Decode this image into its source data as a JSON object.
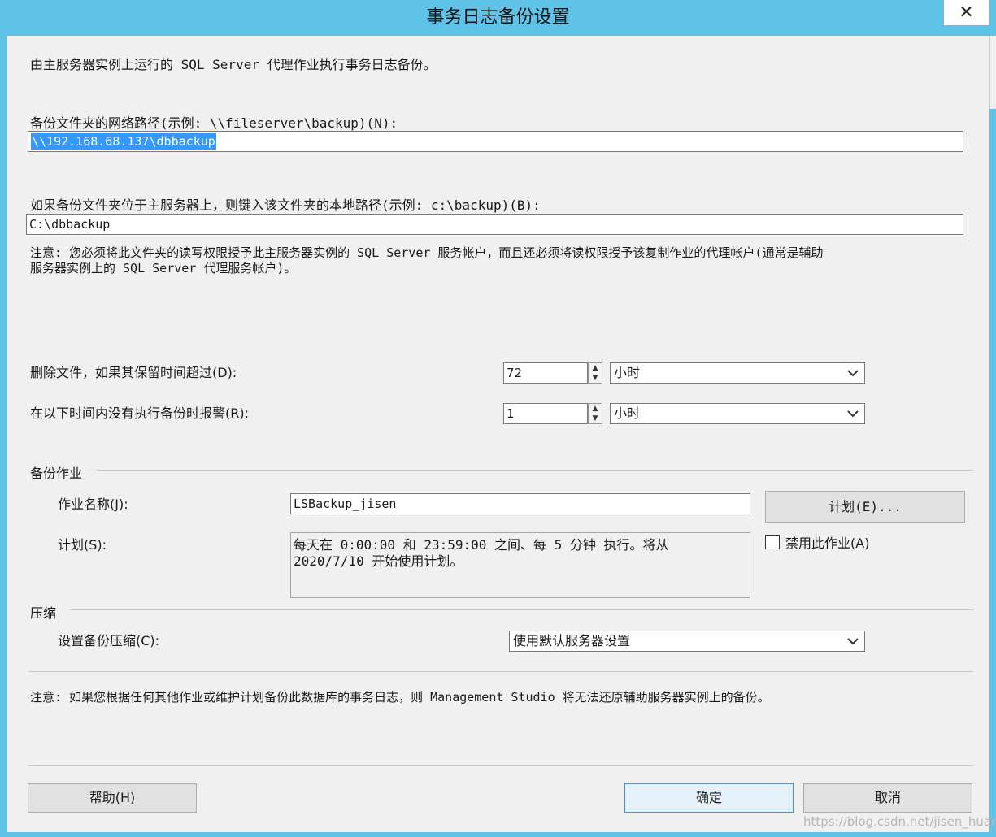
{
  "window": {
    "title": "事务日志备份设置",
    "close_glyph": "✕"
  },
  "intro": "由主服务器实例上运行的 SQL Server 代理作业执行事务日志备份。",
  "network_path": {
    "label": "备份文件夹的网络路径(示例: \\\\fileserver\\backup)(N):",
    "value": "\\\\192.168.68.137\\dbbackup"
  },
  "local_path": {
    "label": "如果备份文件夹位于主服务器上，则键入该文件夹的本地路径(示例: c:\\backup)(B):",
    "value": "C:\\dbbackup"
  },
  "note1": {
    "line1": "注意: 您必须将此文件夹的读写权限授予此主服务器实例的 SQL Server 服务帐户，而且还必须将读权限授予该复制作业的代理帐户(通常是辅助",
    "line2": "服务器实例上的 SQL Server 代理服务帐户)。"
  },
  "delete_files": {
    "label": "删除文件，如果其保留时间超过(D):",
    "value": "72",
    "unit": "小时"
  },
  "alert": {
    "label": "在以下时间内没有执行备份时报警(R):",
    "value": "1",
    "unit": "小时"
  },
  "backup_job": {
    "group_label": "备份作业",
    "name_label": "作业名称(J):",
    "name_value": "LSBackup_jisen",
    "schedule_button": "计划(E)...",
    "schedule_label": "计划(S):",
    "schedule_line1": "每天在 0:00:00 和 23:59:00 之间、每 5 分钟 执行。将从",
    "schedule_line2": "2020/7/10 开始使用计划。",
    "disable_label": "禁用此作业(A)"
  },
  "compression": {
    "group_label": "压缩",
    "label": "设置备份压缩(C):",
    "value": "使用默认服务器设置"
  },
  "note2": "注意: 如果您根据任何其他作业或维护计划备份此数据库的事务日志，则 Management Studio 将无法还原辅助服务器实例上的备份。",
  "buttons": {
    "help": "帮助(H)",
    "ok": "确定",
    "cancel": "取消"
  },
  "watermark": "https://blog.csdn.net/jisen_huang",
  "colors": {
    "titlebar": "#5fc3e8",
    "client": "#f0f0f0",
    "selection": "#3399ff"
  }
}
